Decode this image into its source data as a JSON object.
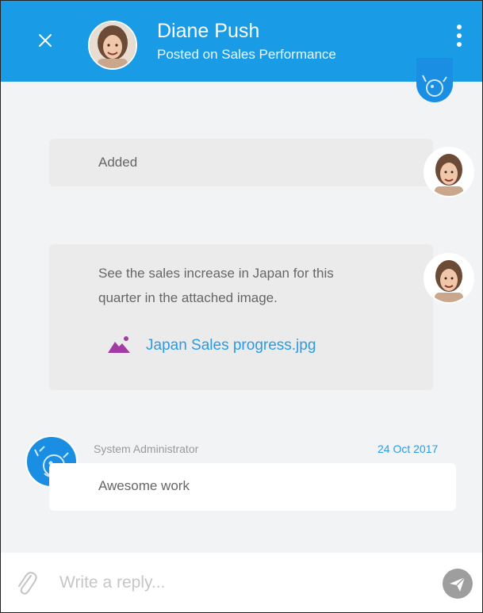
{
  "header": {
    "name": "Diane Push",
    "posted_prefix": "Posted on",
    "posted_on": "Sales Performance"
  },
  "messages": [
    {
      "text": "Added"
    },
    {
      "text_line1": "See the sales increase in Japan for this",
      "text_line2": "quarter in the attached image.",
      "attachment": "Japan Sales progress.jpg"
    },
    {
      "author": "System Administrator",
      "date": "24 Oct 2017",
      "text": "Awesome work"
    }
  ],
  "composer": {
    "placeholder": "Write a reply..."
  },
  "colors": {
    "header": "#1a9be6",
    "accent_link": "#2b9be3",
    "attachment_icon": "#a33aa6",
    "bubble": "#ebebeb"
  }
}
